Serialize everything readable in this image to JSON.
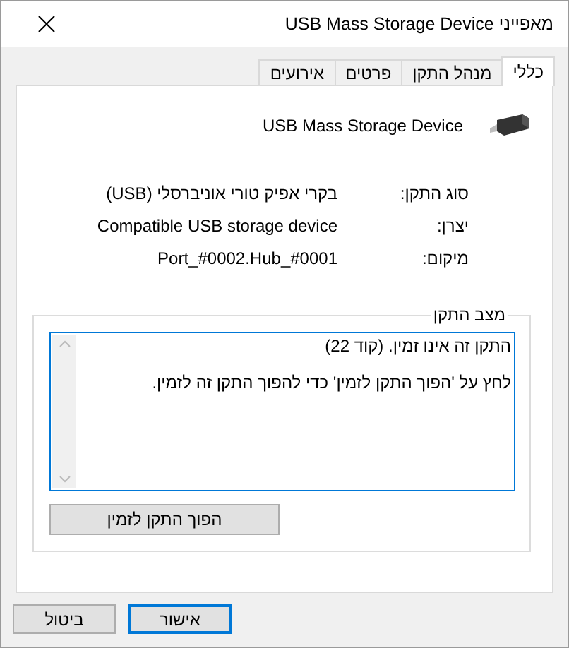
{
  "window": {
    "title": "מאפייני USB Mass Storage Device"
  },
  "tabs": [
    {
      "label": "כללי",
      "selected": true
    },
    {
      "label": "מנהל התקן",
      "selected": false
    },
    {
      "label": "פרטים",
      "selected": false
    },
    {
      "label": "אירועים",
      "selected": false
    }
  ],
  "device": {
    "name": "USB Mass Storage Device"
  },
  "properties": [
    {
      "label": "סוג התקן:",
      "value": "בקרי אפיק טורי אוניברסלי (USB)"
    },
    {
      "label": "יצרן:",
      "value": "Compatible USB storage device"
    },
    {
      "label": "מיקום:",
      "value": "Port_#0002.Hub_#0001"
    }
  ],
  "status": {
    "legend": "מצב התקן",
    "lines": [
      "התקן זה אינו זמין. (קוד 22)",
      "לחץ על 'הפוך התקן לזמין' כדי להפוך התקן זה לזמין."
    ],
    "action": "הפוך התקן לזמין"
  },
  "buttons": [
    {
      "label": "אישור",
      "default": true
    },
    {
      "label": "ביטול",
      "default": false
    }
  ]
}
